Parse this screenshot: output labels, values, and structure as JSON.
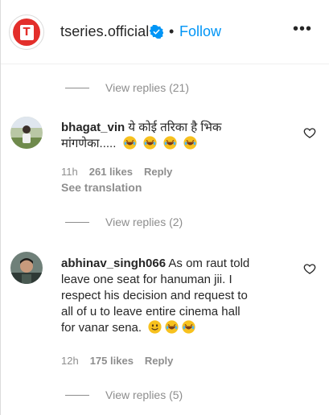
{
  "header": {
    "username": "tseries.official",
    "separator": "•",
    "follow_label": "Follow",
    "more_label": "•••"
  },
  "view_replies": [
    "View replies (21)",
    "View replies (2)",
    "View replies (5)"
  ],
  "comments": [
    {
      "username": "bhagat_vin",
      "text_line1": " ये कोई तरिका है भिक",
      "text_line2": "मांगणेका.....",
      "emoji_count": 4,
      "time": "11h",
      "likes": "261 likes",
      "reply": "Reply",
      "see_translation": "See translation"
    },
    {
      "username": "abhinav_singh066",
      "text_line1": " As om raut told",
      "text_line2": "leave one seat for hanuman jii. I",
      "text_line3": "respect his decision and request to",
      "text_line4": "all of u to leave entire cinema hall",
      "text_line5": "for vanar sena. ",
      "time": "12h",
      "likes": "175 likes",
      "reply": "Reply"
    }
  ],
  "colors": {
    "link_blue": "#0095f6",
    "secondary_gray": "#8e8e8e",
    "brand_red": "#e32f2b"
  }
}
